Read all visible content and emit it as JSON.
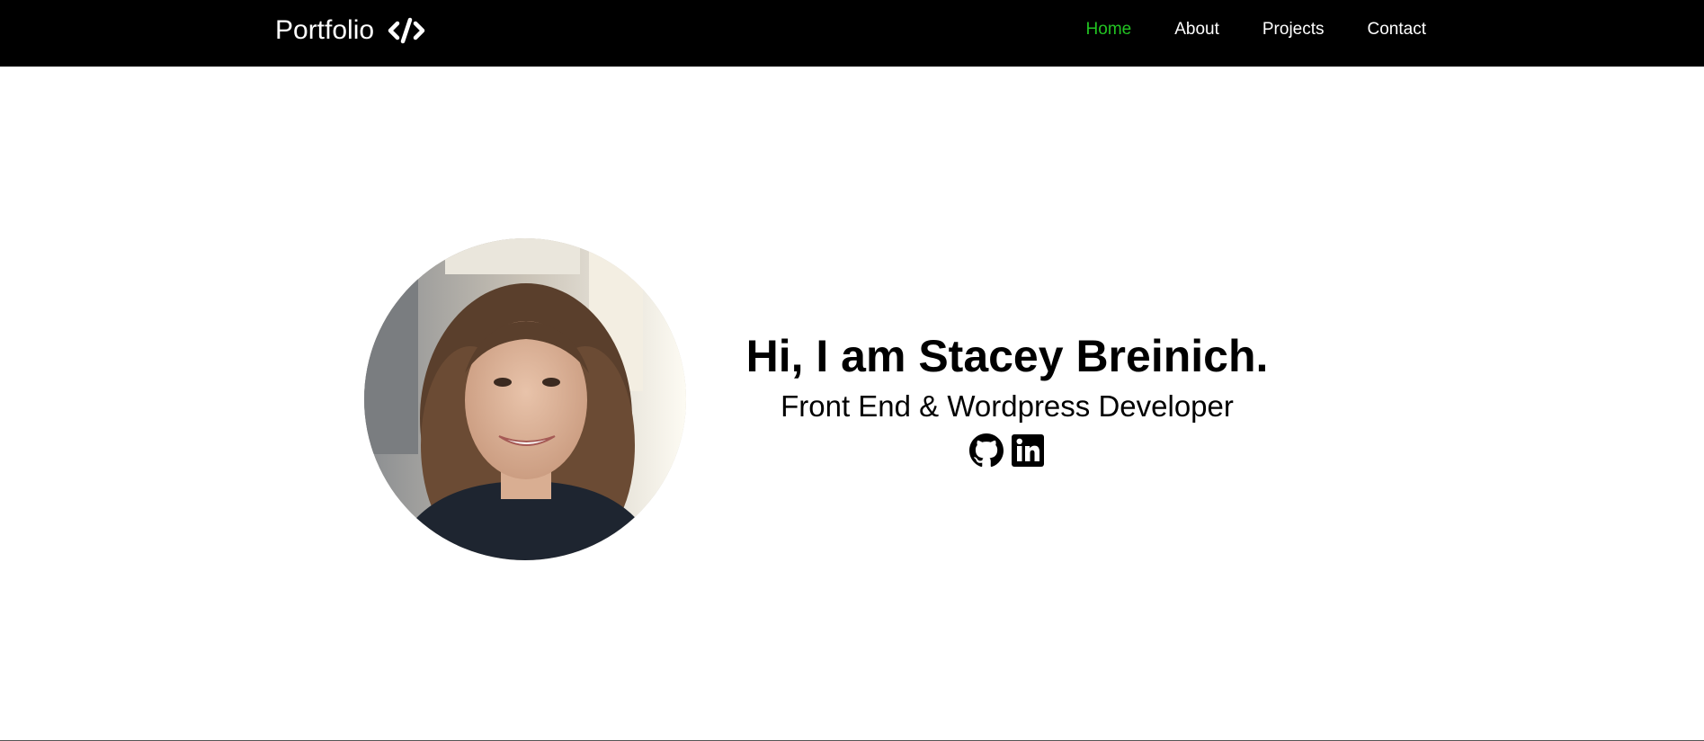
{
  "navbar": {
    "brand": "Portfolio",
    "brand_icon": "code-icon",
    "links": [
      {
        "label": "Home",
        "active": true
      },
      {
        "label": "About",
        "active": false
      },
      {
        "label": "Projects",
        "active": false
      },
      {
        "label": "Contact",
        "active": false
      }
    ]
  },
  "hero": {
    "title": "Hi, I am Stacey Breinich.",
    "subtitle": "Front End & Wordpress Developer",
    "socials": [
      {
        "icon": "github-icon"
      },
      {
        "icon": "linkedin-icon"
      }
    ]
  },
  "colors": {
    "navbar_bg": "#000000",
    "nav_text": "#ffffff",
    "nav_active": "#22c322",
    "page_bg": "#ffffff",
    "text": "#000000"
  }
}
